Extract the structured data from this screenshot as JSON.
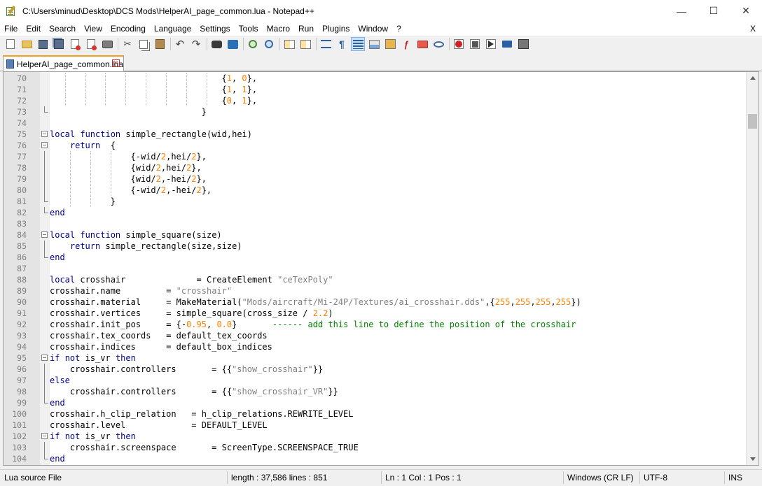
{
  "window": {
    "title": "C:\\Users\\minud\\Desktop\\DCS Mods\\HelperAI_page_common.lua - Notepad++",
    "minimize": "—",
    "maximize": "☐",
    "close": "✕"
  },
  "menu": {
    "items": [
      "File",
      "Edit",
      "Search",
      "View",
      "Encoding",
      "Language",
      "Settings",
      "Tools",
      "Macro",
      "Run",
      "Plugins",
      "Window",
      "?"
    ],
    "close_doc": "X"
  },
  "toolbar": {
    "icons": [
      "new-file-icon",
      "open-file-icon",
      "save-icon",
      "save-all-icon",
      "close-icon",
      "close-all-icon",
      "print-icon",
      "cut-icon",
      "copy-icon",
      "paste-icon",
      "undo-icon",
      "redo-icon",
      "find-icon",
      "replace-icon",
      "zoom-in-icon",
      "zoom-out-icon",
      "sync-vertical-icon",
      "sync-horizontal-icon",
      "word-wrap-icon",
      "show-all-characters-icon",
      "indent-guide-icon",
      "user-defined-language-icon",
      "document-map-icon",
      "function-list-icon",
      "folder-as-workspace-icon",
      "monitoring-icon",
      "record-macro-icon",
      "stop-recording-icon",
      "playback-macro-icon",
      "run-macro-multiple-icon",
      "save-macro-icon"
    ]
  },
  "tab": {
    "label": "HelperAI_page_common.lua",
    "active_color": "#fa9c1e"
  },
  "editor": {
    "lines": [
      {
        "n": "70",
        "indent": 34,
        "guides": [
          3,
          7,
          11,
          15,
          19,
          23,
          27,
          31
        ],
        "parts": [
          [
            "p",
            "{"
          ],
          [
            "num",
            "1"
          ],
          [
            "p",
            ", "
          ],
          [
            "num",
            "0"
          ],
          [
            "p",
            "},"
          ]
        ]
      },
      {
        "n": "71",
        "indent": 34,
        "guides": [
          3,
          7,
          11,
          15,
          19,
          23,
          27,
          31
        ],
        "parts": [
          [
            "p",
            "{"
          ],
          [
            "num",
            "1"
          ],
          [
            "p",
            ", "
          ],
          [
            "num",
            "1"
          ],
          [
            "p",
            "},"
          ]
        ]
      },
      {
        "n": "72",
        "indent": 34,
        "guides": [
          3,
          7,
          11,
          15,
          19,
          23,
          27,
          31
        ],
        "parts": [
          [
            "p",
            "{"
          ],
          [
            "num",
            "0"
          ],
          [
            "p",
            ", "
          ],
          [
            "num",
            "1"
          ],
          [
            "p",
            "},"
          ]
        ]
      },
      {
        "n": "73",
        "indent": 30,
        "guides": [],
        "fold": "end",
        "parts": [
          [
            "p",
            "}"
          ]
        ]
      },
      {
        "n": "74",
        "indent": 0,
        "guides": [],
        "parts": []
      },
      {
        "n": "75",
        "indent": 0,
        "guides": [],
        "fold": "open",
        "parts": [
          [
            "kw",
            "local"
          ],
          [
            "p",
            " "
          ],
          [
            "kw",
            "function"
          ],
          [
            "p",
            " simple_rectangle(wid,hei)"
          ]
        ]
      },
      {
        "n": "76",
        "indent": 4,
        "guides": [],
        "fold": "open",
        "parts": [
          [
            "kw",
            "return"
          ],
          [
            "p",
            "  {"
          ]
        ]
      },
      {
        "n": "77",
        "indent": 16,
        "guides": [
          4,
          8,
          12
        ],
        "fold": "line",
        "parts": [
          [
            "p",
            "{-wid/"
          ],
          [
            "num",
            "2"
          ],
          [
            "p",
            ",hei/"
          ],
          [
            "num",
            "2"
          ],
          [
            "p",
            "},"
          ]
        ]
      },
      {
        "n": "78",
        "indent": 16,
        "guides": [
          4,
          8,
          12
        ],
        "fold": "line",
        "parts": [
          [
            "p",
            "{wid/"
          ],
          [
            "num",
            "2"
          ],
          [
            "p",
            ",hei/"
          ],
          [
            "num",
            "2"
          ],
          [
            "p",
            "},"
          ]
        ]
      },
      {
        "n": "79",
        "indent": 16,
        "guides": [
          4,
          8,
          12
        ],
        "fold": "line",
        "parts": [
          [
            "p",
            "{wid/"
          ],
          [
            "num",
            "2"
          ],
          [
            "p",
            ",-hei/"
          ],
          [
            "num",
            "2"
          ],
          [
            "p",
            "},"
          ]
        ]
      },
      {
        "n": "80",
        "indent": 16,
        "guides": [
          4,
          8,
          12
        ],
        "fold": "line",
        "parts": [
          [
            "p",
            "{-wid/"
          ],
          [
            "num",
            "2"
          ],
          [
            "p",
            ",-hei/"
          ],
          [
            "num",
            "2"
          ],
          [
            "p",
            "},"
          ]
        ]
      },
      {
        "n": "81",
        "indent": 12,
        "guides": [
          4,
          8
        ],
        "fold": "end",
        "parts": [
          [
            "p",
            "}"
          ]
        ]
      },
      {
        "n": "82",
        "indent": 0,
        "guides": [],
        "fold": "end",
        "parts": [
          [
            "kw",
            "end"
          ]
        ]
      },
      {
        "n": "83",
        "indent": 0,
        "guides": [],
        "parts": []
      },
      {
        "n": "84",
        "indent": 0,
        "guides": [],
        "fold": "open",
        "parts": [
          [
            "kw",
            "local"
          ],
          [
            "p",
            " "
          ],
          [
            "kw",
            "function"
          ],
          [
            "p",
            " simple_square(size)"
          ]
        ]
      },
      {
        "n": "85",
        "indent": 4,
        "guides": [],
        "fold": "line",
        "parts": [
          [
            "kw",
            "return"
          ],
          [
            "p",
            " simple_rectangle(size,size)"
          ]
        ]
      },
      {
        "n": "86",
        "indent": 0,
        "guides": [],
        "fold": "end",
        "parts": [
          [
            "kw",
            "end"
          ]
        ]
      },
      {
        "n": "87",
        "indent": 0,
        "guides": [],
        "parts": []
      },
      {
        "n": "88",
        "indent": 0,
        "guides": [],
        "parts": [
          [
            "kw",
            "local"
          ],
          [
            "p",
            " crosshair              = CreateElement "
          ],
          [
            "str",
            "\"ceTexPoly\""
          ]
        ]
      },
      {
        "n": "89",
        "indent": 0,
        "guides": [],
        "parts": [
          [
            "p",
            "crosshair.name         = "
          ],
          [
            "str",
            "\"crosshair\""
          ]
        ]
      },
      {
        "n": "90",
        "indent": 0,
        "guides": [],
        "parts": [
          [
            "p",
            "crosshair.material     = MakeMaterial("
          ],
          [
            "str",
            "\"Mods/aircraft/Mi-24P/Textures/ai_crosshair.dds\""
          ],
          [
            "p",
            ",{"
          ],
          [
            "num",
            "255"
          ],
          [
            "p",
            ","
          ],
          [
            "num",
            "255"
          ],
          [
            "p",
            ","
          ],
          [
            "num",
            "255"
          ],
          [
            "p",
            ","
          ],
          [
            "num",
            "255"
          ],
          [
            "p",
            "})"
          ]
        ]
      },
      {
        "n": "91",
        "indent": 0,
        "guides": [],
        "parts": [
          [
            "p",
            "crosshair.vertices     = simple_square(cross_size / "
          ],
          [
            "num",
            "2.2"
          ],
          [
            "p",
            ")"
          ]
        ]
      },
      {
        "n": "92",
        "indent": 0,
        "guides": [],
        "parts": [
          [
            "p",
            "crosshair.init_pos     = {-"
          ],
          [
            "num",
            "0.95"
          ],
          [
            "p",
            ", "
          ],
          [
            "num",
            "0.0"
          ],
          [
            "p",
            "}       "
          ],
          [
            "cmt",
            "------ add this line to define the position of the crosshair"
          ]
        ]
      },
      {
        "n": "93",
        "indent": 0,
        "guides": [],
        "parts": [
          [
            "p",
            "crosshair.tex_coords   = default_tex_coords"
          ]
        ]
      },
      {
        "n": "94",
        "indent": 0,
        "guides": [],
        "parts": [
          [
            "p",
            "crosshair.indices      = default_box_indices"
          ]
        ]
      },
      {
        "n": "95",
        "indent": 0,
        "guides": [],
        "fold": "open",
        "parts": [
          [
            "kw",
            "if"
          ],
          [
            "p",
            " "
          ],
          [
            "kw",
            "not"
          ],
          [
            "p",
            " is_vr "
          ],
          [
            "kw",
            "then"
          ]
        ]
      },
      {
        "n": "96",
        "indent": 4,
        "guides": [],
        "fold": "line",
        "parts": [
          [
            "p",
            "crosshair.controllers       = {{"
          ],
          [
            "str",
            "\"show_crosshair\""
          ],
          [
            "p",
            "}}"
          ]
        ]
      },
      {
        "n": "97",
        "indent": 0,
        "guides": [],
        "fold": "line",
        "parts": [
          [
            "kw",
            "else"
          ]
        ]
      },
      {
        "n": "98",
        "indent": 4,
        "guides": [],
        "fold": "line",
        "parts": [
          [
            "p",
            "crosshair.controllers       = {{"
          ],
          [
            "str",
            "\"show_crosshair_VR\""
          ],
          [
            "p",
            "}}"
          ]
        ]
      },
      {
        "n": "99",
        "indent": 0,
        "guides": [],
        "fold": "end",
        "parts": [
          [
            "kw",
            "end"
          ]
        ]
      },
      {
        "n": "100",
        "indent": 0,
        "guides": [],
        "parts": [
          [
            "p",
            "crosshair.h_clip_relation   = h_clip_relations.REWRITE_LEVEL"
          ]
        ]
      },
      {
        "n": "101",
        "indent": 0,
        "guides": [],
        "parts": [
          [
            "p",
            "crosshair.level             = DEFAULT_LEVEL"
          ]
        ]
      },
      {
        "n": "102",
        "indent": 0,
        "guides": [],
        "fold": "open",
        "parts": [
          [
            "kw",
            "if"
          ],
          [
            "p",
            " "
          ],
          [
            "kw",
            "not"
          ],
          [
            "p",
            " is_vr "
          ],
          [
            "kw",
            "then"
          ]
        ]
      },
      {
        "n": "103",
        "indent": 4,
        "guides": [],
        "fold": "line",
        "parts": [
          [
            "p",
            "crosshair.screenspace       = ScreenType.SCREENSPACE_TRUE"
          ]
        ]
      },
      {
        "n": "104",
        "indent": 0,
        "guides": [],
        "fold": "end",
        "parts": [
          [
            "kw",
            "end"
          ]
        ]
      }
    ]
  },
  "statusbar": {
    "file_type": "Lua source File",
    "length_lines": "length : 37,586    lines : 851",
    "position": "Ln : 1    Col : 1    Pos : 1",
    "eol": "Windows (CR LF)",
    "encoding": "UTF-8",
    "mode": "INS"
  }
}
